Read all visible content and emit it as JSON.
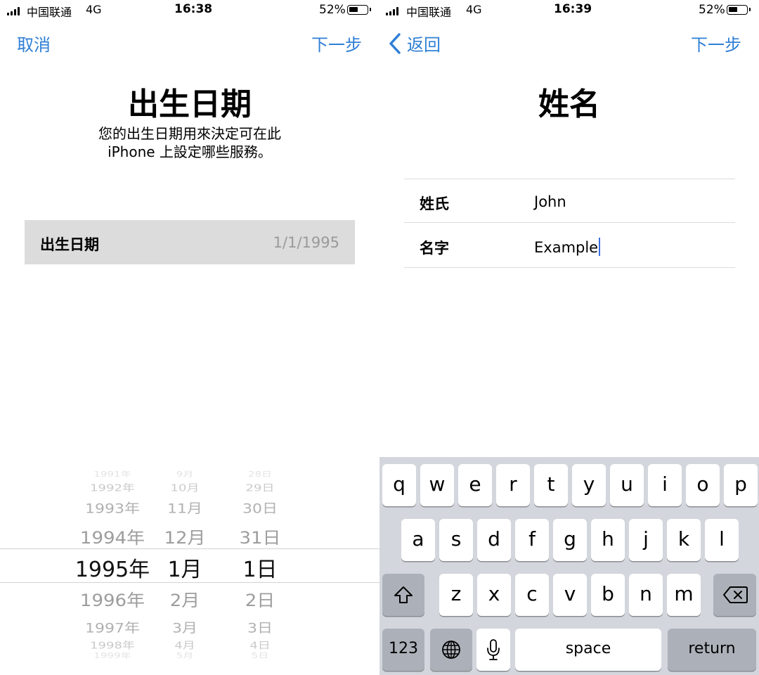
{
  "left_screen": {
    "status": {
      "carrier": "中国联通",
      "network": "4G",
      "time": "16:38",
      "battery_pct": "52%",
      "battery_level": 0.52
    },
    "nav": {
      "cancel": "取消",
      "next": "下一步"
    },
    "title": "出生日期",
    "subtitle": "您的出生日期用來決定可在此\niPhone 上設定哪些服務。",
    "dob_row": {
      "label": "出生日期",
      "value": "1/1/1995"
    },
    "picker": {
      "years": [
        "1991年",
        "1992年",
        "1993年",
        "1994年",
        "1995年",
        "1996年",
        "1997年",
        "1998年",
        "1999年"
      ],
      "months": [
        "9月",
        "10月",
        "11月",
        "12月",
        "1月",
        "2月",
        "3月",
        "4月",
        "5月"
      ],
      "days": [
        "28日",
        "29日",
        "30日",
        "31日",
        "1日",
        "2日",
        "3日",
        "4日",
        "5日"
      ],
      "selected_index": 4
    }
  },
  "right_screen": {
    "status": {
      "carrier": "中国联通",
      "network": "4G",
      "time": "16:39",
      "battery_pct": "52%",
      "battery_level": 0.52
    },
    "nav": {
      "back": "返回",
      "next": "下一步"
    },
    "title": "姓名",
    "form": {
      "last_name_label": "姓氏",
      "last_name_value": "John",
      "first_name_label": "名字",
      "first_name_value": "Example"
    },
    "keyboard": {
      "row1": [
        "q",
        "w",
        "e",
        "r",
        "t",
        "y",
        "u",
        "i",
        "o",
        "p"
      ],
      "row2": [
        "a",
        "s",
        "d",
        "f",
        "g",
        "h",
        "j",
        "k",
        "l"
      ],
      "row3": [
        "z",
        "x",
        "c",
        "v",
        "b",
        "n",
        "m"
      ],
      "numbers": "123",
      "space": "space",
      "return": "return",
      "icons": {
        "shift": "shift-icon",
        "delete": "delete-icon",
        "globe": "globe-icon",
        "mic": "microphone-icon"
      }
    }
  },
  "colors": {
    "accent": "#2f7fd6",
    "caret": "#3a6fe0",
    "keyboard_bg": "#d3d6dc",
    "dark_key": "#acb1b9"
  }
}
